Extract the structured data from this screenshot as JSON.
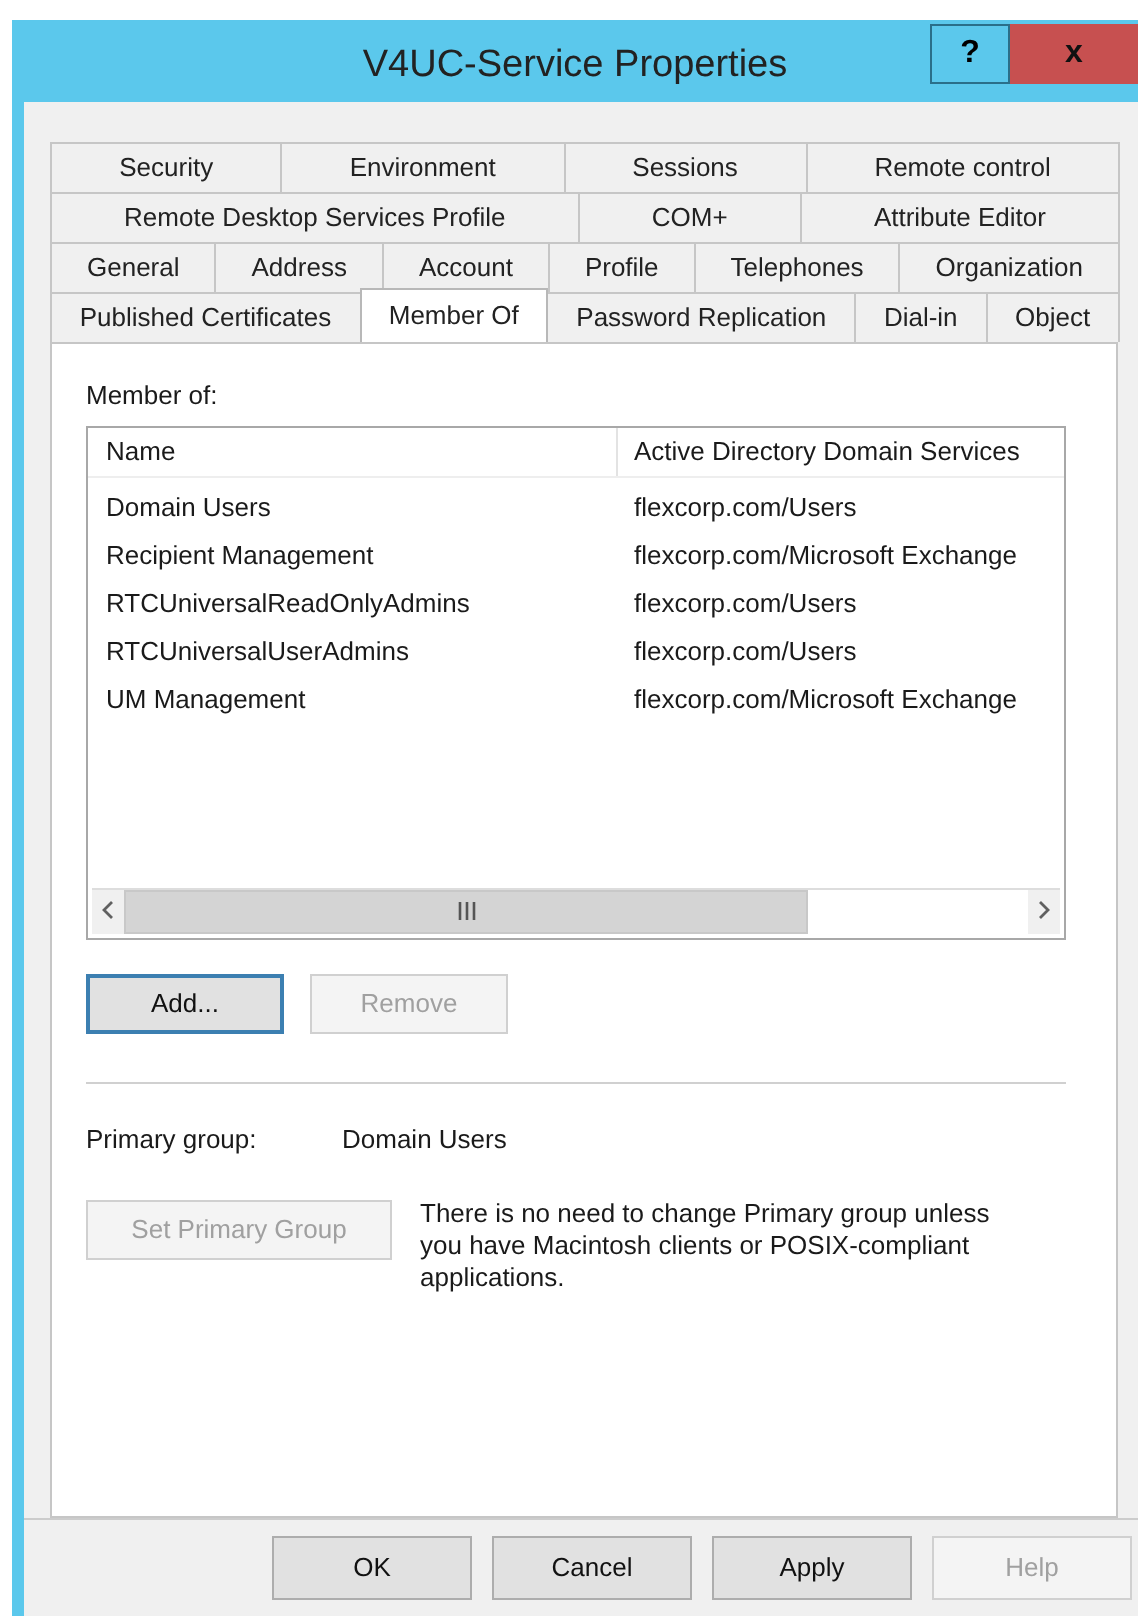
{
  "window": {
    "title": "V4UC-Service Properties",
    "help_button": "?",
    "close_button": "x"
  },
  "tab_rows": [
    [
      {
        "label": "Security",
        "selected": false
      },
      {
        "label": "Environment",
        "selected": false
      },
      {
        "label": "Sessions",
        "selected": false
      },
      {
        "label": "Remote control",
        "selected": false
      }
    ],
    [
      {
        "label": "Remote Desktop Services Profile",
        "selected": false
      },
      {
        "label": "COM+",
        "selected": false
      },
      {
        "label": "Attribute Editor",
        "selected": false
      }
    ],
    [
      {
        "label": "General",
        "selected": false
      },
      {
        "label": "Address",
        "selected": false
      },
      {
        "label": "Account",
        "selected": false
      },
      {
        "label": "Profile",
        "selected": false
      },
      {
        "label": "Telephones",
        "selected": false
      },
      {
        "label": "Organization",
        "selected": false
      }
    ],
    [
      {
        "label": "Published Certificates",
        "selected": false
      },
      {
        "label": "Member Of",
        "selected": true
      },
      {
        "label": "Password Replication",
        "selected": false
      },
      {
        "label": "Dial-in",
        "selected": false
      },
      {
        "label": "Object",
        "selected": false
      }
    ]
  ],
  "member_of": {
    "label": "Member of:",
    "columns": [
      "Name",
      "Active Directory Domain Services"
    ],
    "rows": [
      {
        "name": "Domain Users",
        "folder": "flexcorp.com/Users"
      },
      {
        "name": "Recipient Management",
        "folder": "flexcorp.com/Microsoft Exchange"
      },
      {
        "name": "RTCUniversalReadOnlyAdmins",
        "folder": "flexcorp.com/Users"
      },
      {
        "name": "RTCUniversalUserAdmins",
        "folder": "flexcorp.com/Users"
      },
      {
        "name": "UM Management",
        "folder": "flexcorp.com/Microsoft Exchange"
      }
    ]
  },
  "list_buttons": [
    {
      "label": "Add...",
      "disabled": false,
      "focused": true
    },
    {
      "label": "Remove",
      "disabled": true,
      "focused": false
    }
  ],
  "primary_group": {
    "label": "Primary group:",
    "value": "Domain Users"
  },
  "set_primary_button": {
    "label": "Set Primary Group",
    "disabled": true
  },
  "note": "There is no need to change Primary group unless you have Macintosh clients or POSIX-compliant applications.",
  "dialog_buttons": [
    {
      "label": "OK",
      "disabled": false
    },
    {
      "label": "Cancel",
      "disabled": false
    },
    {
      "label": "Apply",
      "disabled": false
    },
    {
      "label": "Help",
      "disabled": true
    }
  ]
}
